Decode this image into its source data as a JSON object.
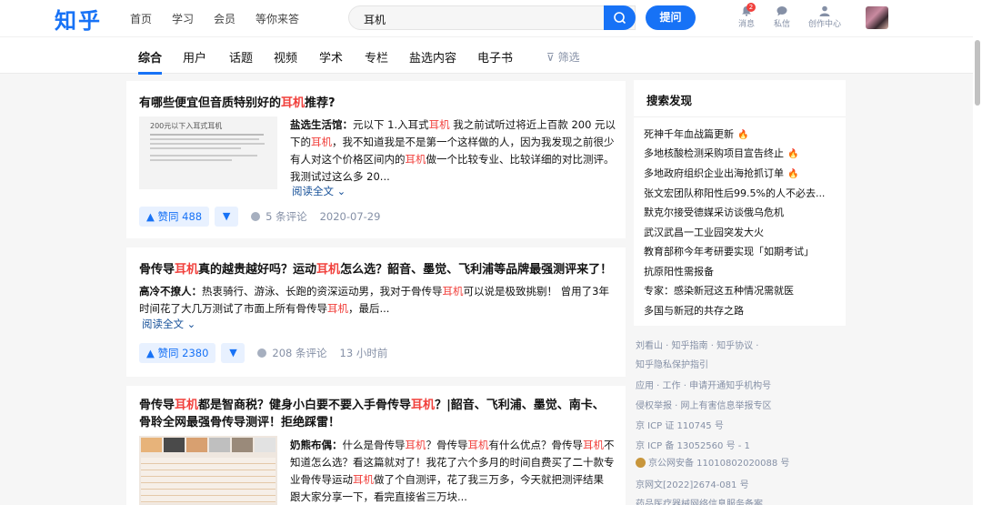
{
  "header": {
    "logo": "知乎",
    "nav": [
      "首页",
      "学习",
      "会员",
      "等你来答"
    ],
    "search_value": "耳机",
    "ask_label": "提问",
    "notifications": {
      "label": "消息",
      "count": "2"
    },
    "messages_label": "私信",
    "creator_label": "创作中心"
  },
  "tabs": [
    "综合",
    "用户",
    "话题",
    "视频",
    "学术",
    "专栏",
    "盐选内容",
    "电子书"
  ],
  "filter_label": "筛选",
  "results": [
    {
      "title_pre": "有哪些便宜但音质特别好的",
      "title_hl": "耳机",
      "title_post": "推荐?",
      "thumb_caption": "200元以下入耳式耳机",
      "author": "盐选生活馆：",
      "excerpt_lines": [
        [
          "元以下 1.入耳式",
          "耳机",
          " 我之前试听过将近上百款 200 元以"
        ],
        [
          "下的",
          "耳机",
          "，我不知道我是不是第一个这样做的人，因为我发现之前很少"
        ],
        [
          "有人对这个价格区间内的",
          "耳机",
          "做一个比较专业、比较详细的对比测评。"
        ],
        [
          "我测试过这么多 20...",
          "",
          ""
        ]
      ],
      "read_more": "阅读全文 ⌄",
      "votes": "▲ 赞同 488",
      "comments": "5 条评论",
      "time": "2020-07-29"
    },
    {
      "title_line1": [
        "骨传导",
        "耳机",
        "真的越贵越好吗？运动",
        "耳机",
        "怎么选？韶音、墨觉、飞利浦等品牌最强测评来了！"
      ],
      "author": "高冷不撩人：",
      "excerpt_lines": [
        [
          "热衷骑行、游泳、长跑的资深运动男，我对于骨传导",
          "耳机",
          "可以说是极致挑剔！ 曾用了3年"
        ],
        [
          "时间花了大几万测试了市面上所有骨传导",
          "耳机",
          "，最后..."
        ]
      ],
      "read_more": "阅读全文 ⌄",
      "votes": "▲ 赞同 2380",
      "comments": "208 条评论",
      "time": "13 小时前"
    },
    {
      "title_line1": [
        "骨传导",
        "耳机",
        "都是智商税？健身小白要不要入手骨传导",
        "耳机",
        "？|韶音、飞利浦、墨觉、南卡、"
      ],
      "title_line2": "骨聆全网最强骨传导测评！拒绝踩雷！",
      "author": "奶熊布偶：",
      "excerpt_lines": [
        [
          "什么是骨传导",
          "耳机",
          "？骨传导",
          "耳机",
          "有什么优点？骨传导",
          "耳机",
          "不"
        ],
        [
          "知道怎么选？看这篇就对了！我花了六个多月的时间自费买了二十款专",
          "",
          ""
        ],
        [
          "业骨传导运动",
          "耳机",
          "做了个自测评，花了我三万多，今天就把测评结果"
        ],
        [
          "跟大家分享一下，看完直接省三万块...",
          "",
          ""
        ]
      ]
    }
  ],
  "sidebar": {
    "title": "搜索发现",
    "items": [
      {
        "text": "死神千年血战篇更新",
        "hot": true
      },
      {
        "text": "多地核酸检测采购项目宣告终止",
        "hot": true
      },
      {
        "text": "多地政府组织企业出海抢抓订单",
        "hot": true
      },
      {
        "text": "张文宏团队称阳性后99.5%的人不必去...",
        "hot": false
      },
      {
        "text": "默克尔接受德媒采访谈俄乌危机",
        "hot": false
      },
      {
        "text": "武汉武昌一工业园突发大火",
        "hot": false
      },
      {
        "text": "教育部称今年考研要实现「如期考试」",
        "hot": false
      },
      {
        "text": "抗原阳性需报备",
        "hot": false
      },
      {
        "text": "专家：感染新冠这五种情况需就医",
        "hot": false
      },
      {
        "text": "多国与新冠的共存之路",
        "hot": false
      }
    ]
  },
  "footer": [
    "刘看山 · 知乎指南 · 知乎协议 ·",
    "知乎隐私保护指引",
    "应用 · 工作 · 申请开通知乎机构号",
    "侵权举报 · 网上有害信息举报专区",
    "京 ICP 证 110745 号",
    "京 ICP 备 13052560 号 - 1",
    "京公网安备 11010802020088 号",
    "京网文[2022]2674-081 号",
    "药品医疗器械网络信息服务备案"
  ]
}
